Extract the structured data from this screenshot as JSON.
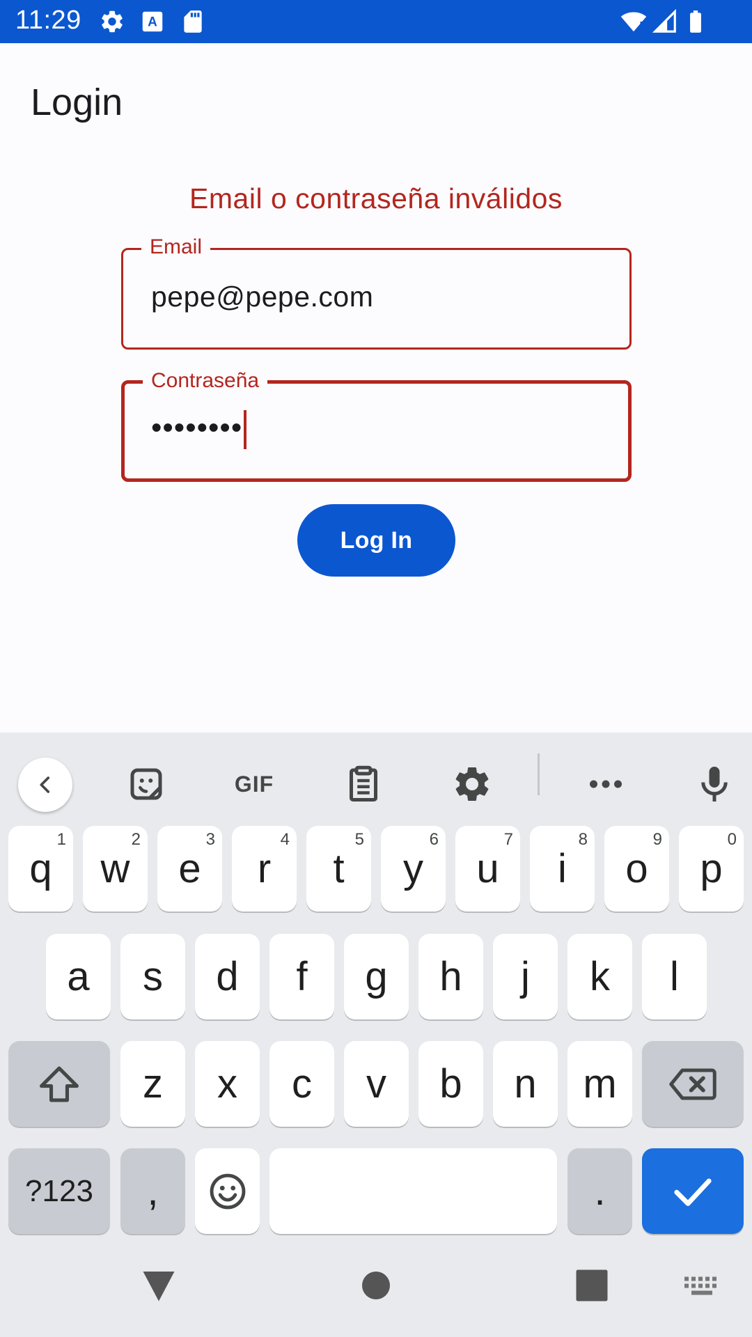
{
  "status_bar": {
    "time": "11:29",
    "icons": [
      "gear-icon",
      "text-a-icon",
      "sd-card-icon",
      "wifi-icon",
      "signal-icon",
      "battery-icon"
    ],
    "background": "#0b57d0"
  },
  "app_bar": {
    "title": "Login"
  },
  "form": {
    "error_message": "Email o contraseña inválidos",
    "email": {
      "label": "Email",
      "value": "pepe@pepe.com"
    },
    "password": {
      "label": "Contraseña",
      "value": "••••••••"
    },
    "login_button": "Log In",
    "error_color": "#b3261e",
    "accent_color": "#0b57d0"
  },
  "keyboard": {
    "toolbar": [
      "back-icon",
      "sticker-icon",
      "GIF",
      "clipboard-icon",
      "gear-icon",
      "more-icon",
      "mic-icon"
    ],
    "gif_label": "GIF",
    "rows": {
      "row1": [
        {
          "label": "q",
          "hint": "1"
        },
        {
          "label": "w",
          "hint": "2"
        },
        {
          "label": "e",
          "hint": "3"
        },
        {
          "label": "r",
          "hint": "4"
        },
        {
          "label": "t",
          "hint": "5"
        },
        {
          "label": "y",
          "hint": "6"
        },
        {
          "label": "u",
          "hint": "7"
        },
        {
          "label": "i",
          "hint": "8"
        },
        {
          "label": "o",
          "hint": "9"
        },
        {
          "label": "p",
          "hint": "0"
        }
      ],
      "row2": [
        "a",
        "s",
        "d",
        "f",
        "g",
        "h",
        "j",
        "k",
        "l"
      ],
      "row3": [
        "z",
        "x",
        "c",
        "v",
        "b",
        "n",
        "m"
      ],
      "row4": {
        "symbols": "?123",
        "comma": ",",
        "period": "."
      }
    },
    "enter_color": "#1b6fde"
  },
  "nav_bar": [
    "back-triangle-icon",
    "home-circle-icon",
    "recents-square-icon",
    "keyboard-switch-icon"
  ]
}
